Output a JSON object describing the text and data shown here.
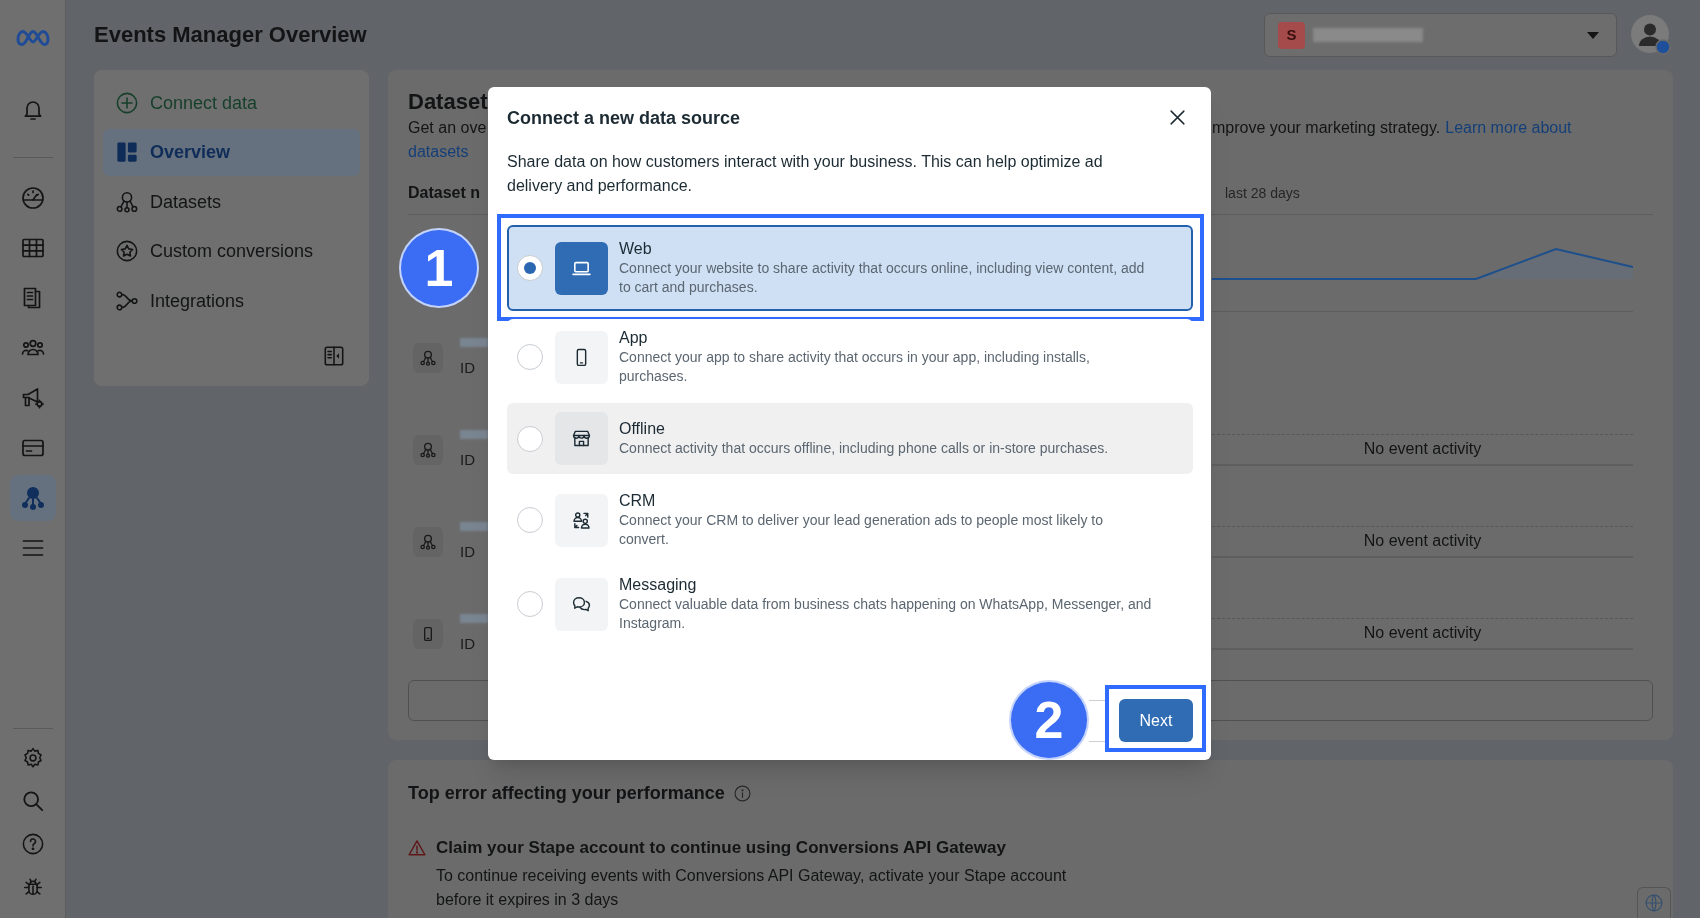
{
  "rail": {
    "items": [
      {
        "selected": false
      },
      {
        "selected": false
      },
      {
        "selected": false
      },
      {
        "selected": false
      },
      {
        "selected": false
      },
      {
        "selected": false
      },
      {
        "selected": false
      },
      {
        "selected": true
      },
      {
        "selected": false
      }
    ]
  },
  "header": {
    "title": "Events Manager Overview",
    "account_initial": "S"
  },
  "nav": {
    "items": [
      {
        "kind": "action",
        "label": "Connect data",
        "selected": false
      },
      {
        "kind": "page",
        "label": "Overview",
        "selected": true
      },
      {
        "kind": "page",
        "label": "Datasets",
        "selected": false
      },
      {
        "kind": "page",
        "label": "Custom conversions",
        "selected": false
      },
      {
        "kind": "page",
        "label": "Integrations",
        "selected": false
      }
    ]
  },
  "datasets_card": {
    "title": "Dataset",
    "intro_start": "Get an ove",
    "intro_end": "mprove your marketing strategy.",
    "link_start": "Learn more about",
    "link_end": "datasets",
    "name_column": "Dataset n",
    "range_label": "last 28 days",
    "rows": [
      {
        "kind": "trend"
      },
      {
        "kind": "dataset",
        "id": "ID"
      },
      {
        "kind": "dataset",
        "id": "ID",
        "activity": "No event activity"
      },
      {
        "kind": "dataset",
        "id": "ID",
        "activity": "No event activity"
      },
      {
        "kind": "app",
        "id": "ID",
        "activity": "No event activity"
      }
    ]
  },
  "top_error_card": {
    "title": "Top error affecting your performance",
    "error_title": "Claim your Stape account to continue using Conversions API Gateway",
    "error_text": "To continue receiving events with Conversions API Gateway, activate your Stape account before it expires in 3 days"
  },
  "modal": {
    "title": "Connect a new data source",
    "description": "Share data on how customers interact with your business. This can help optimize ad delivery and performance.",
    "options": [
      {
        "kind": "web",
        "title": "Web",
        "description": "Connect your website to share activity that occurs online, including view content, add to cart and purchases.",
        "selected": true,
        "hovered": false,
        "highlighted": true
      },
      {
        "kind": "app",
        "title": "App",
        "description": "Connect your app to share activity that occurs in your app, including installs, purchases.",
        "selected": false,
        "hovered": false,
        "highlighted": false
      },
      {
        "kind": "offline",
        "title": "Offline",
        "description": "Connect activity that occurs offline, including phone calls or in-store purchases.",
        "selected": false,
        "hovered": true,
        "highlighted": false
      },
      {
        "kind": "crm",
        "title": "CRM",
        "description": "Connect your CRM to deliver your lead generation ads to people most likely to convert.",
        "selected": false,
        "hovered": false,
        "highlighted": false
      },
      {
        "kind": "messaging",
        "title": "Messaging",
        "description": "Connect valuable data from business chats happening on WhatsApp, Messenger, and Instagram.",
        "selected": false,
        "hovered": false,
        "highlighted": false
      }
    ],
    "next_button": {
      "label": "Next",
      "highlighted": true
    }
  },
  "step_badges": [
    "1",
    "2"
  ]
}
